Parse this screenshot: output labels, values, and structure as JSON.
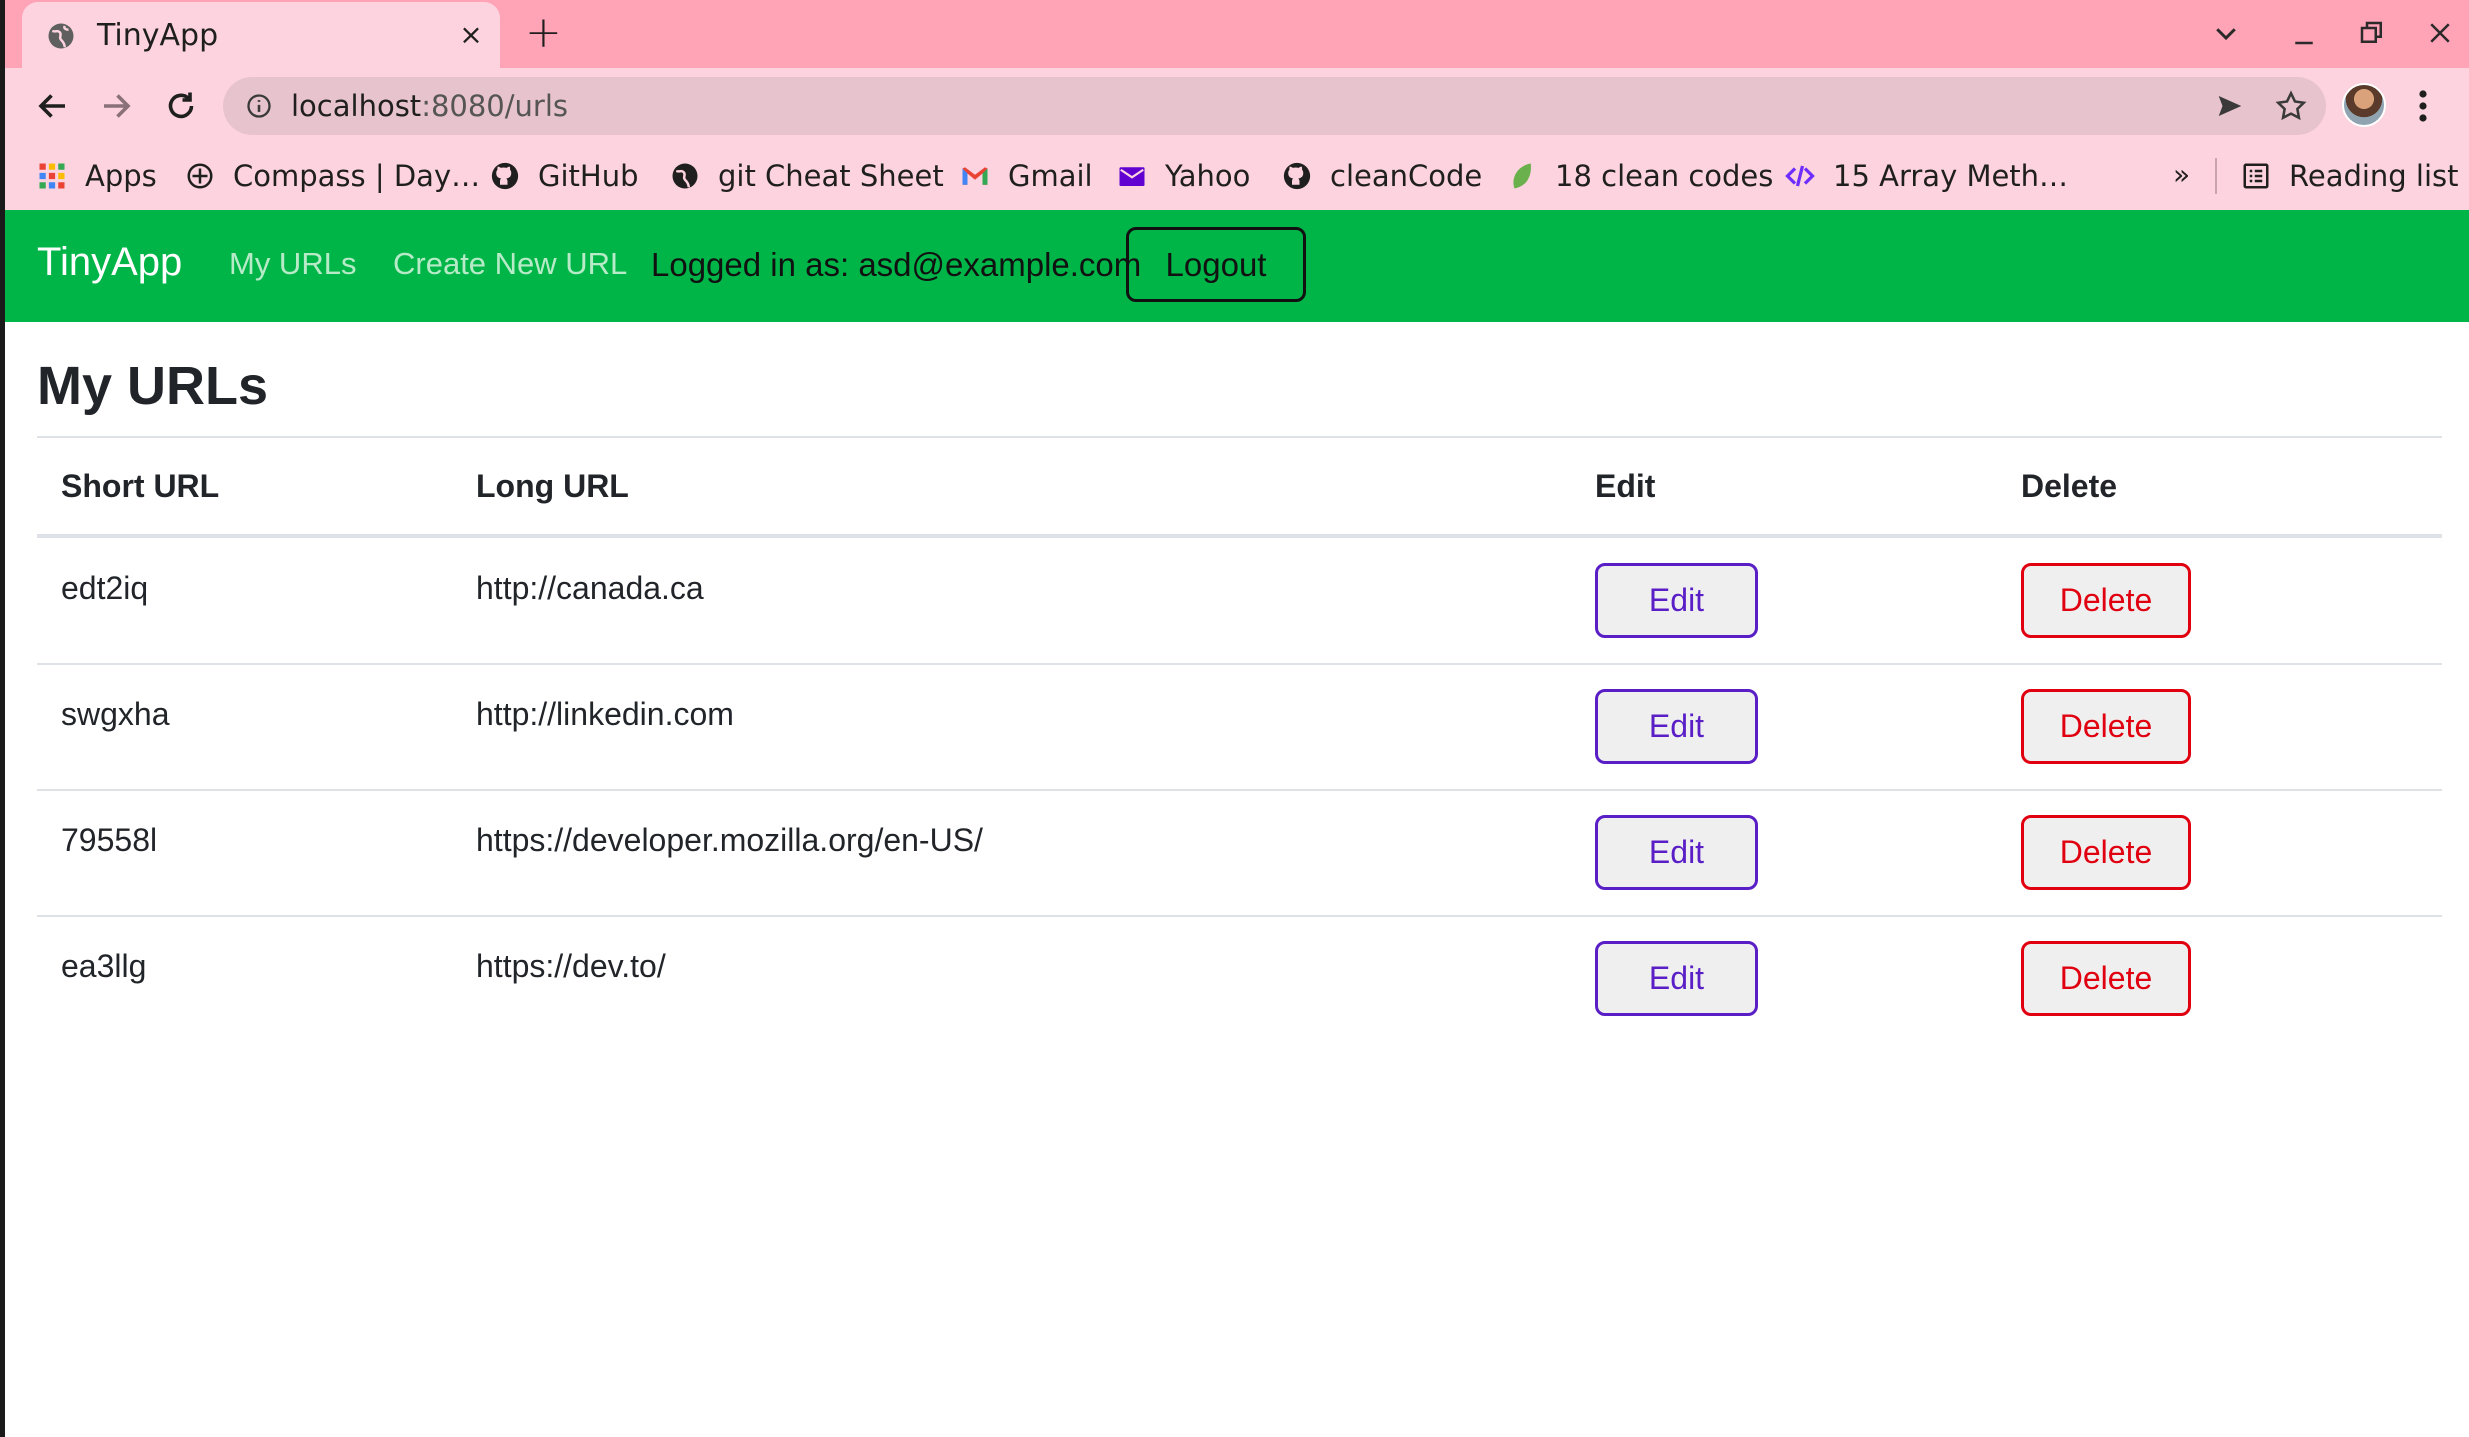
{
  "browser": {
    "tab_title": "TinyApp",
    "tab_close": "×",
    "new_tab": "+",
    "url_host": "localhost",
    "url_rest": ":8080/urls",
    "bookmarks": [
      {
        "label": "Apps",
        "icon": "apps-grid-icon"
      },
      {
        "label": "Compass | Day…",
        "icon": "compass-icon"
      },
      {
        "label": "GitHub",
        "icon": "github-icon"
      },
      {
        "label": "git Cheat Sheet",
        "icon": "globe-icon"
      },
      {
        "label": "Gmail",
        "icon": "gmail-icon"
      },
      {
        "label": "Yahoo",
        "icon": "yahoo-mail-icon"
      },
      {
        "label": "cleanCode",
        "icon": "github-icon"
      },
      {
        "label": "18 clean codes",
        "icon": "leaf-icon"
      },
      {
        "label": "15 Array Meth…",
        "icon": "code-icon"
      }
    ],
    "bookmarks_overflow": "»",
    "reading_list": "Reading list"
  },
  "app": {
    "brand": "TinyApp",
    "nav": {
      "my_urls": "My URLs",
      "create_new": "Create New URL",
      "logged_in": "Logged in as: asd@example.com",
      "logout": "Logout"
    },
    "page_title": "My URLs",
    "table": {
      "headers": [
        "Short URL",
        "Long URL",
        "Edit",
        "Delete"
      ],
      "rows": [
        {
          "short": "edt2iq",
          "long": "http://canada.ca",
          "edit": "Edit",
          "delete": "Delete"
        },
        {
          "short": "swgxha",
          "long": "http://linkedin.com",
          "edit": "Edit",
          "delete": "Delete"
        },
        {
          "short": "79558l",
          "long": "https://developer.mozilla.org/en-US/",
          "edit": "Edit",
          "delete": "Delete"
        },
        {
          "short": "ea3llg",
          "long": "https://dev.to/",
          "edit": "Edit",
          "delete": "Delete"
        }
      ]
    }
  },
  "colors": {
    "tabstrip": "#ffa3b6",
    "toolbar": "#fcd3de",
    "navbar": "#00b548",
    "edit": "#5a1ec7",
    "delete": "#e0000f"
  }
}
